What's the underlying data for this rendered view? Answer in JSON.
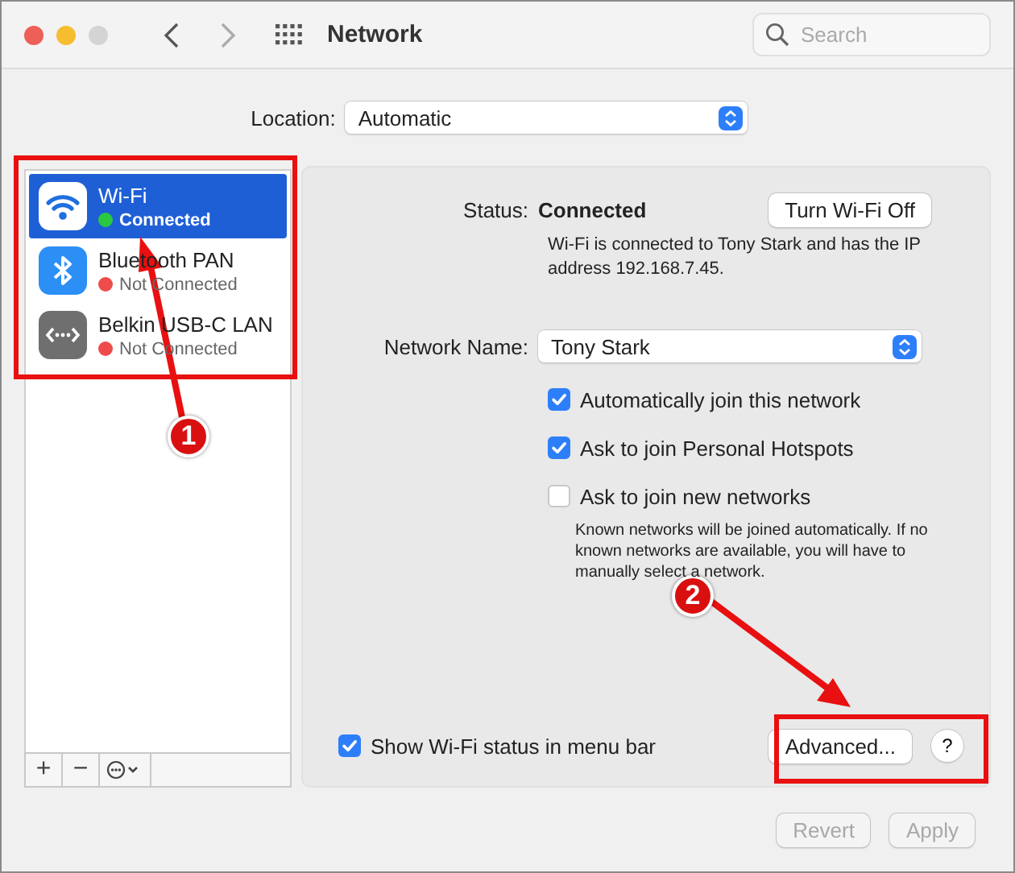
{
  "window": {
    "title": "Network"
  },
  "search": {
    "placeholder": "Search"
  },
  "location": {
    "label": "Location:",
    "value": "Automatic"
  },
  "services": [
    {
      "name": "Wi-Fi",
      "status": "Connected",
      "kind": "wifi",
      "color": "#2ac840",
      "selected": true
    },
    {
      "name": "Bluetooth PAN",
      "status": "Not Connected",
      "kind": "bluetooth",
      "color": "#ee4b4b",
      "selected": false
    },
    {
      "name": "Belkin USB-C LAN",
      "status": "Not Connected",
      "kind": "ethernet",
      "color": "#ee4b4b",
      "selected": false
    }
  ],
  "sidebar_toolbar": {
    "add": "+",
    "remove": "−"
  },
  "status": {
    "label": "Status:",
    "value": "Connected",
    "button": "Turn Wi-Fi Off",
    "description": "Wi-Fi is connected to Tony Stark and has the IP address 192.168.7.45."
  },
  "network_name": {
    "label": "Network Name:",
    "value": "Tony Stark"
  },
  "options": [
    {
      "label": "Automatically join this network",
      "checked": true
    },
    {
      "label": "Ask to join Personal Hotspots",
      "checked": true
    },
    {
      "label": "Ask to join new networks",
      "checked": false
    }
  ],
  "options_note": "Known networks will be joined automatically. If no known networks are available, you will have to manually select a network.",
  "menu_bar_option": {
    "label": "Show Wi-Fi status in menu bar",
    "checked": true
  },
  "advanced_button": "Advanced...",
  "help_button": "?",
  "footer_buttons": [
    {
      "label": "Revert",
      "disabled": true
    },
    {
      "label": "Apply",
      "disabled": true
    }
  ],
  "annotations": [
    {
      "label": "1"
    },
    {
      "label": "2"
    }
  ]
}
